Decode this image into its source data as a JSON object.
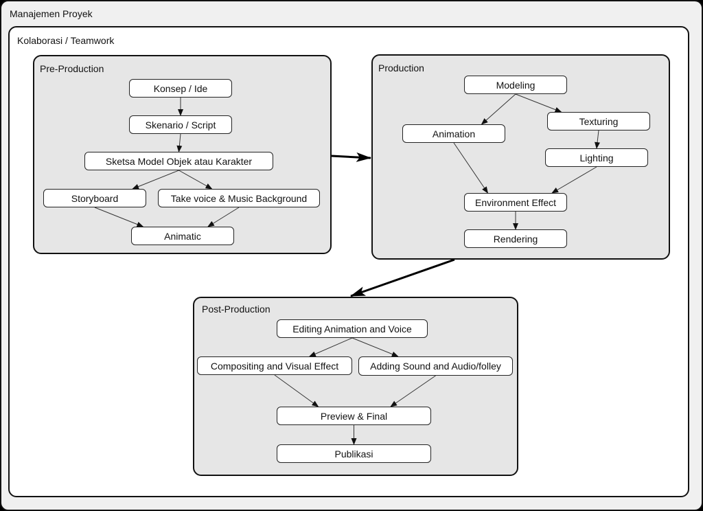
{
  "outer": {
    "title": "Manajemen Proyek"
  },
  "collab": {
    "title": "Kolaborasi / Teamwork"
  },
  "colors": {
    "group_fill": "#e6e6e6",
    "node_fill": "#ffffff",
    "outer_fill": "#f0f0f0",
    "stroke": "#111111"
  },
  "groups": {
    "pre": {
      "title": "Pre-Production"
    },
    "prod": {
      "title": "Production"
    },
    "post": {
      "title": "Post-Production"
    }
  },
  "nodes": {
    "konsep": "Konsep / Ide",
    "skenario": "Skenario / Script",
    "sketsa": "Sketsa Model Objek atau Karakter",
    "storyboard": "Storyboard",
    "voice": "Take voice & Music Background",
    "animatic": "Animatic",
    "modeling": "Modeling",
    "texturing": "Texturing",
    "animation": "Animation",
    "lighting": "Lighting",
    "env": "Environment Effect",
    "rendering": "Rendering",
    "editing": "Editing Animation and Voice",
    "compositing": "Compositing and Visual Effect",
    "sound": "Adding Sound and Audio/folley",
    "preview": "Preview & Final",
    "publikasi": "Publikasi"
  },
  "edges": [
    [
      "konsep",
      "skenario"
    ],
    [
      "skenario",
      "sketsa"
    ],
    [
      "sketsa",
      "storyboard"
    ],
    [
      "sketsa",
      "voice"
    ],
    [
      "storyboard",
      "animatic"
    ],
    [
      "voice",
      "animatic"
    ],
    [
      "modeling",
      "animation"
    ],
    [
      "modeling",
      "texturing"
    ],
    [
      "texturing",
      "lighting"
    ],
    [
      "animation",
      "env"
    ],
    [
      "lighting",
      "env"
    ],
    [
      "env",
      "rendering"
    ],
    [
      "editing",
      "compositing"
    ],
    [
      "editing",
      "sound"
    ],
    [
      "compositing",
      "preview"
    ],
    [
      "sound",
      "preview"
    ],
    [
      "preview",
      "publikasi"
    ]
  ],
  "group_edges": [
    [
      "pre",
      "prod"
    ],
    [
      "prod",
      "post"
    ]
  ]
}
